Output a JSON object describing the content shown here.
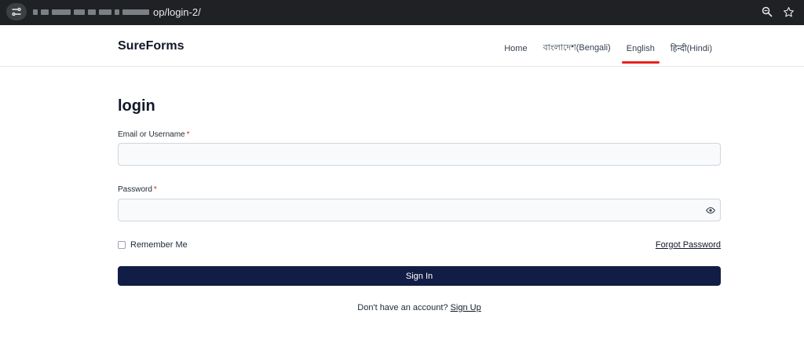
{
  "browser": {
    "url_visible": "op/login-2/",
    "icons": [
      "site-info-icon",
      "zoom-icon",
      "bookmark-star-icon"
    ]
  },
  "header": {
    "brand": "SureForms",
    "nav": [
      {
        "label": "Home",
        "active": false
      },
      {
        "label": "বাংলাদেশ(Bengali)",
        "active": false
      },
      {
        "label": "English",
        "active": true
      },
      {
        "label": "हिन्दी(Hindi)",
        "active": false
      }
    ],
    "active_underline_color": "#e8221b"
  },
  "form": {
    "title": "login",
    "email_label": "Email or Username",
    "password_label": "Password",
    "required_mark": "*",
    "email_value": "",
    "password_value": "",
    "remember_label": "Remember Me",
    "remember_checked": false,
    "forgot_label": "Forgot Password",
    "submit_label": "Sign In",
    "signup_prompt": "Don't have an account?",
    "signup_link": "Sign Up",
    "button_color": "#111d45"
  }
}
